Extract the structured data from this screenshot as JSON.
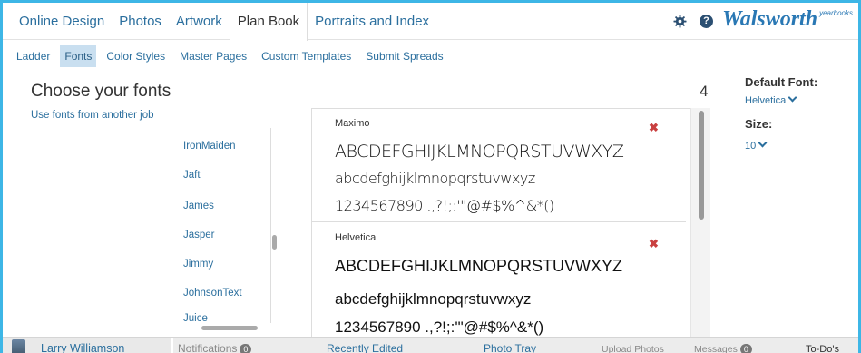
{
  "nav": {
    "tabs": [
      "Online Design",
      "Photos",
      "Artwork",
      "Plan Book",
      "Portraits and Index"
    ],
    "active_tab": "Plan Book",
    "brand": "Walsworth",
    "brand_sup": "yearbooks",
    "help_glyph": "?"
  },
  "subnav": {
    "items": [
      "Ladder",
      "Fonts",
      "Color Styles",
      "Master Pages",
      "Custom Templates",
      "Submit Spreads"
    ],
    "active": "Fonts"
  },
  "page": {
    "title": "Choose your fonts",
    "other_job_link": "Use fonts from another job",
    "selected_count": "4"
  },
  "font_list": [
    "IronMaiden",
    "Jaft",
    "James",
    "Jasper",
    "Jimmy",
    "JohnsonText",
    "Juice"
  ],
  "previews": [
    {
      "name": "Maximo",
      "remove": "✖",
      "line1": "ABCDEFGHIJKLMNOPQRSTUVWXYZ",
      "line2": "abcdefghijklmnopqrstuvwxyz",
      "line3": "1234567890 .,?!;:'\"@#$%^&*()"
    },
    {
      "name": "Helvetica",
      "remove": "✖",
      "line1": "ABCDEFGHIJKLMNOPQRSTUVWXYZ",
      "line2": "abcdefghijklmnopqrstuvwxyz",
      "line3": "1234567890 .,?!;:'\"@#$%^&*()"
    }
  ],
  "settings": {
    "default_font_label": "Default Font:",
    "default_font_value": "Helvetica",
    "size_label": "Size:",
    "size_value": "10"
  },
  "bottom_bar": {
    "user": "Larry Williamson",
    "notifications": "Notifications",
    "notifications_count": "0",
    "recently_edited": "Recently Edited",
    "photo_tray": "Photo Tray",
    "upload_photos": "Upload Photos",
    "messages": "Messages",
    "messages_count": "0",
    "todos": "To-Do's"
  },
  "colors": {
    "accent_border": "#3db6e6",
    "link": "#2b6f9e",
    "active_subnav": "#c9dff0",
    "remove": "#c94040"
  }
}
